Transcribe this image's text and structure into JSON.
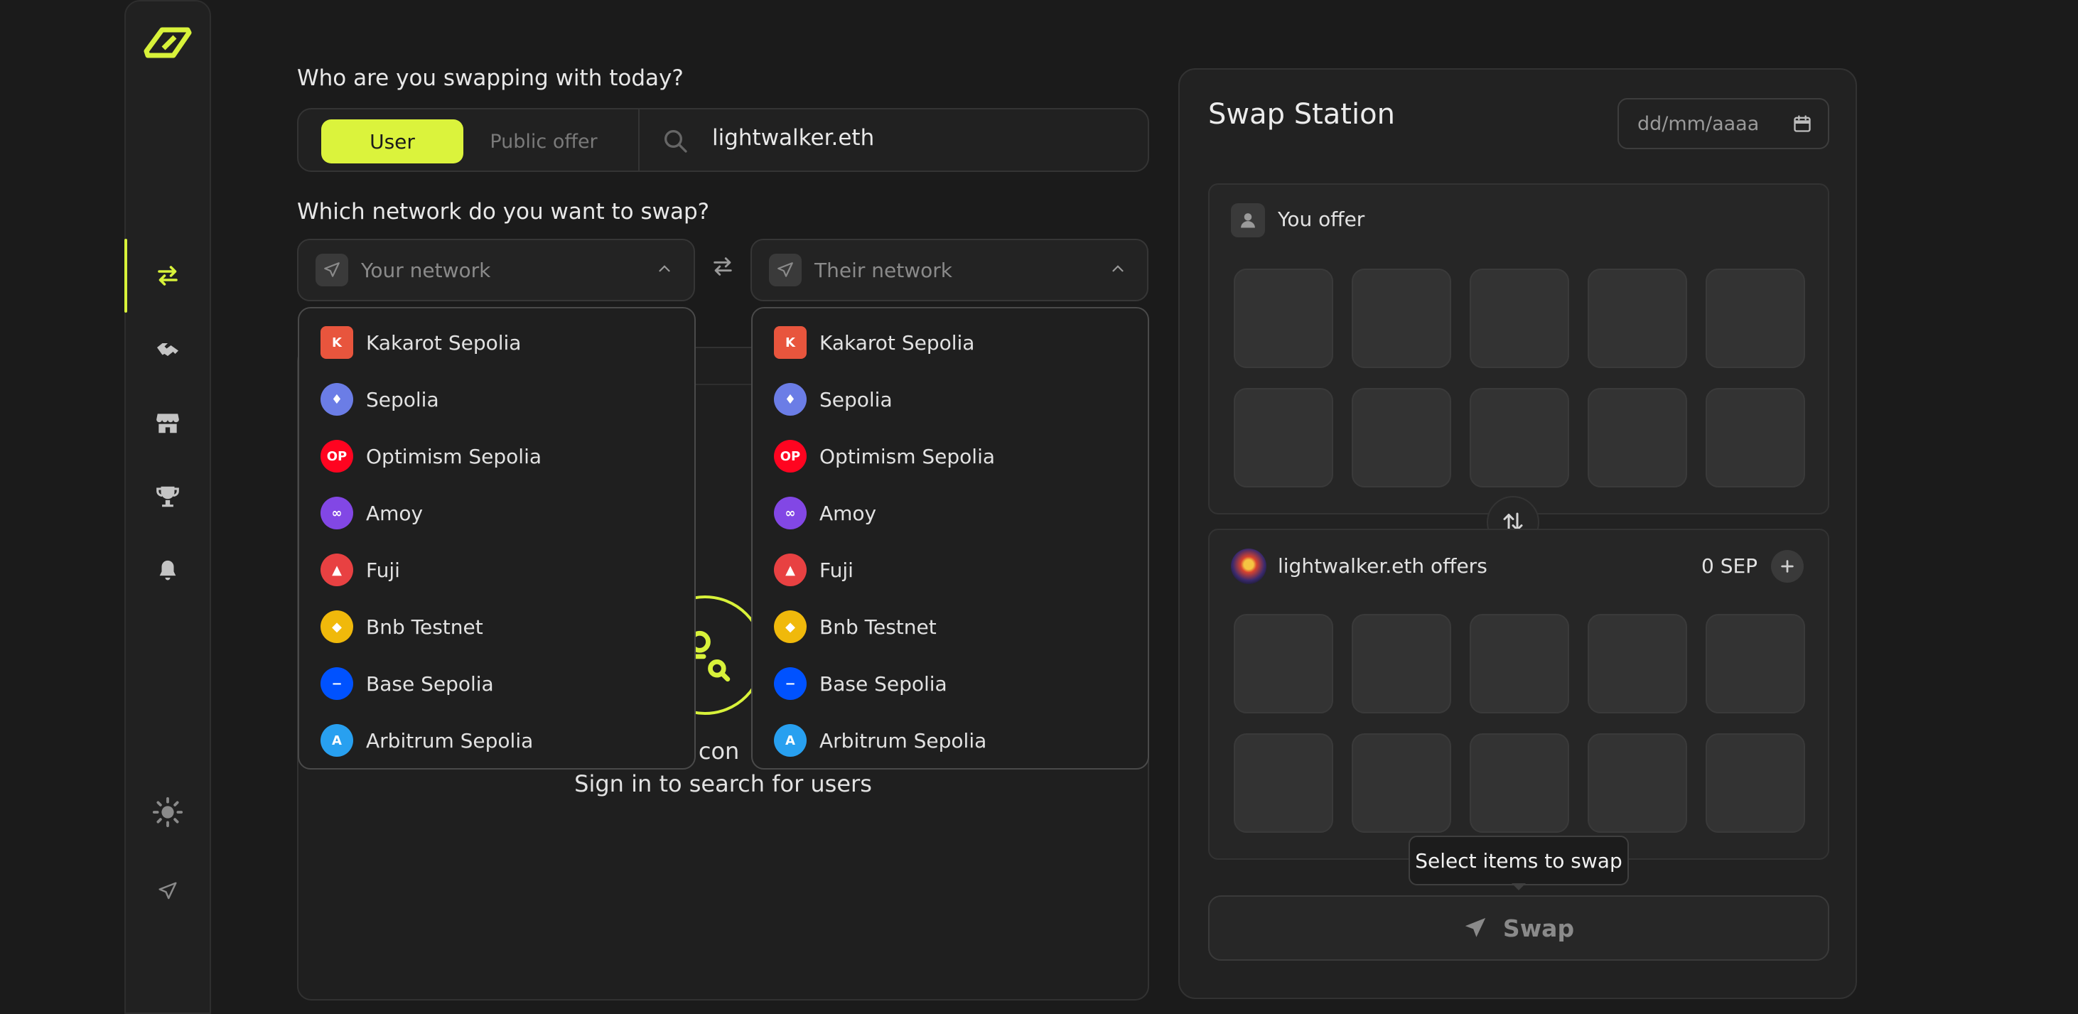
{
  "who_question": "Who are you swapping with today?",
  "toggle": {
    "user": "User",
    "public_offer": "Public offer"
  },
  "search": {
    "value": "lightwalker.eth"
  },
  "network_question": "Which network do you want to swap?",
  "your_network": {
    "placeholder": "Your network"
  },
  "their_network": {
    "placeholder": "Their network"
  },
  "networks": [
    {
      "name": "Kakarot Sepolia",
      "icon": "kakarot-logo",
      "color": "#e8553d"
    },
    {
      "name": "Sepolia",
      "icon": "ethereum-logo",
      "color": "#6b7de6"
    },
    {
      "name": "Optimism Sepolia",
      "icon": "optimism-logo",
      "color": "#ff0420"
    },
    {
      "name": "Amoy",
      "icon": "polygon-logo",
      "color": "#8247e5"
    },
    {
      "name": "Fuji",
      "icon": "avalanche-logo",
      "color": "#e84142"
    },
    {
      "name": "Bnb Testnet",
      "icon": "bnb-logo",
      "color": "#f0b90b"
    },
    {
      "name": "Base Sepolia",
      "icon": "base-logo",
      "color": "#0052ff"
    },
    {
      "name": "Arbitrum Sepolia",
      "icon": "arbitrum-logo",
      "color": "#28a0f0"
    }
  ],
  "empty_state": {
    "partial": "s con",
    "signin": "Sign in to search for users"
  },
  "swap_station": {
    "title": "Swap Station",
    "date_placeholder": "dd/mm/aaaa",
    "you_offer": "You offer",
    "they_offer": "lightwalker.eth offers",
    "balance": "0 SEP",
    "tooltip": "Select items to swap",
    "swap_label": "Swap"
  },
  "colors": {
    "accent": "#dbf33c",
    "background": "#1b1b1b"
  }
}
